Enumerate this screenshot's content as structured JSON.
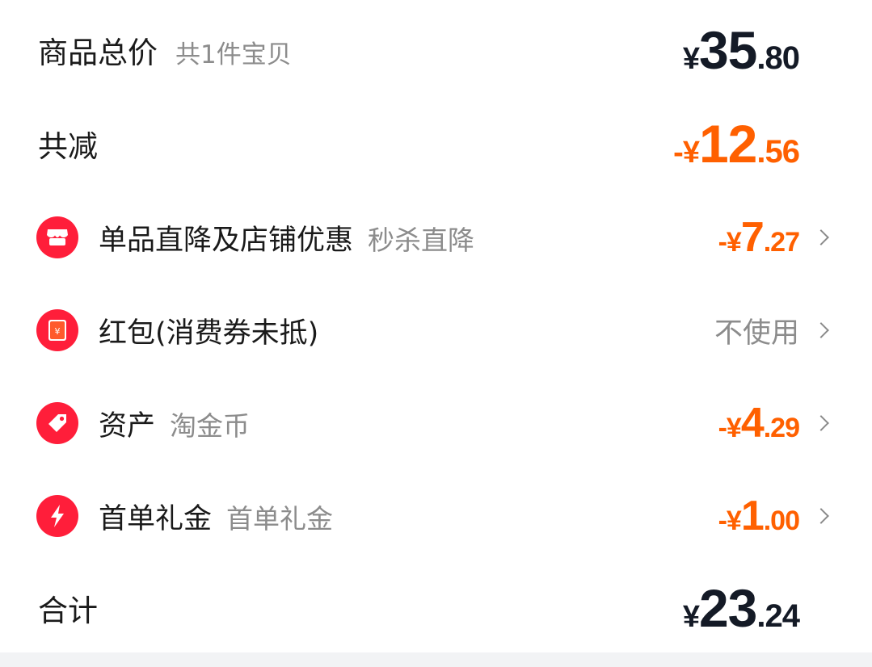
{
  "total": {
    "label": "商品总价",
    "sub": "共1件宝贝",
    "currency": "¥",
    "integer": "35",
    "decimal": ".80"
  },
  "reduction": {
    "label": "共减",
    "prefix": "-¥",
    "integer": "12",
    "decimal": ".56"
  },
  "items": [
    {
      "icon": "shop-icon",
      "label": "单品直降及店铺优惠",
      "sub": "秒杀直降",
      "prefix": "-¥",
      "integer": "7",
      "decimal": ".27"
    },
    {
      "icon": "red-packet-icon",
      "label": "红包(消费券未抵)",
      "sub": "",
      "value_text": "不使用"
    },
    {
      "icon": "tag-icon",
      "label": "资产",
      "sub": "淘金币",
      "prefix": "-¥",
      "integer": "4",
      "decimal": ".29"
    },
    {
      "icon": "lightning-icon",
      "label": "首单礼金",
      "sub": "首单礼金",
      "prefix": "-¥",
      "integer": "1",
      "decimal": ".00"
    }
  ],
  "sum": {
    "label": "合计",
    "currency": "¥",
    "integer": "23",
    "decimal": ".24"
  },
  "colors": {
    "accent": "#ff6000",
    "icon_bg": "#ff1e3a",
    "text_dark": "#141a26"
  }
}
